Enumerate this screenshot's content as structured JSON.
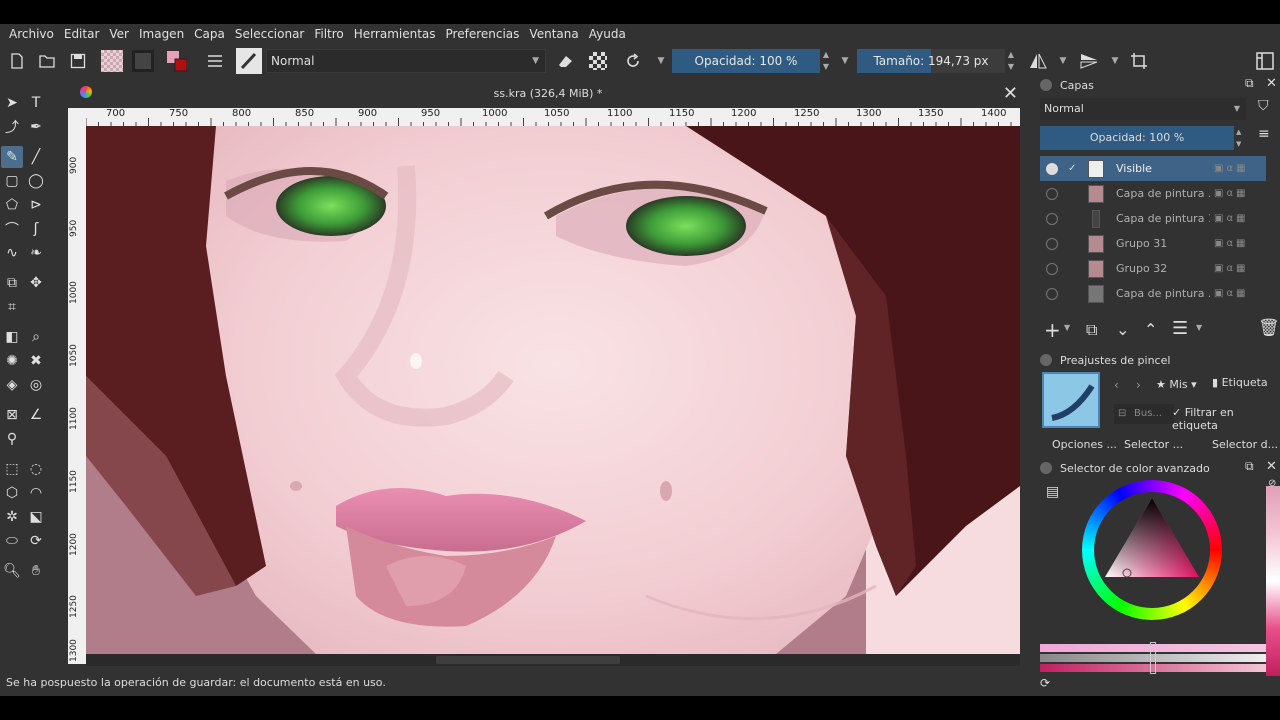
{
  "menu": [
    "Archivo",
    "Editar",
    "Ver",
    "Imagen",
    "Capa",
    "Seleccionar",
    "Filtro",
    "Herramientas",
    "Preferencias",
    "Ventana",
    "Ayuda"
  ],
  "toolbar": {
    "blend_mode": "Normal",
    "opacity_label": "Opacidad: 100 %",
    "size_label": "Tamaño: 194,73 px"
  },
  "document": {
    "title": "ss.kra (326,4 MiB) *",
    "ruler_h": [
      "700",
      "750",
      "800",
      "850",
      "900",
      "950",
      "1000",
      "1050",
      "1100",
      "1150",
      "1200",
      "1250",
      "1300",
      "1350",
      "1400"
    ],
    "ruler_v": [
      "900",
      "950",
      "1000",
      "1050",
      "1100",
      "1150",
      "1200",
      "1250",
      "1300"
    ]
  },
  "status": "Se ha pospuesto la operación de guardar: el documento está en uso.",
  "layers_panel": {
    "title": "Capas",
    "blend_mode": "Normal",
    "opacity_label": "Opacidad:  100 %",
    "layers": [
      {
        "name": "Visible",
        "selected": true
      },
      {
        "name": "Capa de pintura ...",
        "selected": false
      },
      {
        "name": "Capa de pintura 1",
        "selected": false
      },
      {
        "name": "Grupo 31",
        "selected": false
      },
      {
        "name": "Grupo 32",
        "selected": false
      },
      {
        "name": "Capa de pintura ...",
        "selected": false
      }
    ]
  },
  "brush_presets": {
    "title": "Preajustes de pincel",
    "tag_filter": "Mis",
    "tag_label": "Etiqueta",
    "search_placeholder": "Bus...",
    "filter_label": "Filtrar en etiqueta"
  },
  "dock_tabs": [
    "Opciones ...",
    "Selector ...",
    "Selector d..."
  ],
  "color_selector": {
    "title": "Selector de color avanzado",
    "current_color": "#c23a6a"
  },
  "colors": {
    "accent": "#2f5b82",
    "panel_bg": "#323232",
    "selected_layer": "#3e6386"
  }
}
